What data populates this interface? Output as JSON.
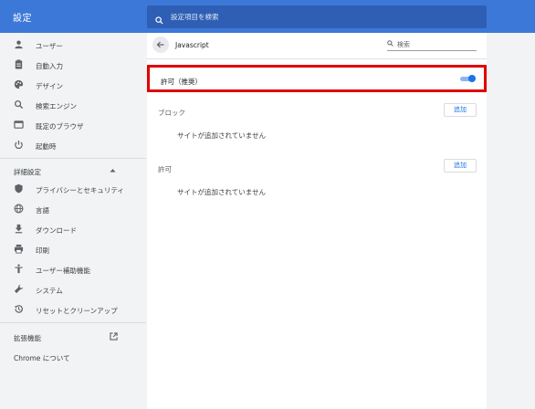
{
  "header": {
    "title": "設定",
    "search_placeholder": "設定項目を検索"
  },
  "sidebar": {
    "items": [
      {
        "label": "ユーザー",
        "icon": "person-icon"
      },
      {
        "label": "自動入力",
        "icon": "clipboard-icon"
      },
      {
        "label": "デザイン",
        "icon": "palette-icon"
      },
      {
        "label": "検索エンジン",
        "icon": "search-icon"
      },
      {
        "label": "既定のブラウザ",
        "icon": "browser-icon"
      },
      {
        "label": "起動時",
        "icon": "power-icon"
      }
    ],
    "advanced_label": "詳細設定",
    "advanced_items": [
      {
        "label": "プライバシーとセキュリティ",
        "icon": "shield-icon"
      },
      {
        "label": "言語",
        "icon": "globe-icon"
      },
      {
        "label": "ダウンロード",
        "icon": "download-icon"
      },
      {
        "label": "印刷",
        "icon": "printer-icon"
      },
      {
        "label": "ユーザー補助機能",
        "icon": "accessibility-icon"
      },
      {
        "label": "システム",
        "icon": "wrench-icon"
      },
      {
        "label": "リセットとクリーンアップ",
        "icon": "restore-icon"
      }
    ],
    "extensions_label": "拡張機能",
    "about_label": "Chrome について"
  },
  "main": {
    "title": "Javascript",
    "search_placeholder": "検索",
    "allow_label": "許可（推奨）",
    "allow_enabled": true,
    "block_section": {
      "title": "ブロック",
      "add_label": "追加",
      "empty_message": "サイトが追加されていません"
    },
    "allow_section": {
      "title": "許可",
      "add_label": "追加",
      "empty_message": "サイトが追加されていません"
    }
  },
  "colors": {
    "header": "#3c78d8",
    "accent": "#1a73e8",
    "highlight_border": "#e00000"
  }
}
